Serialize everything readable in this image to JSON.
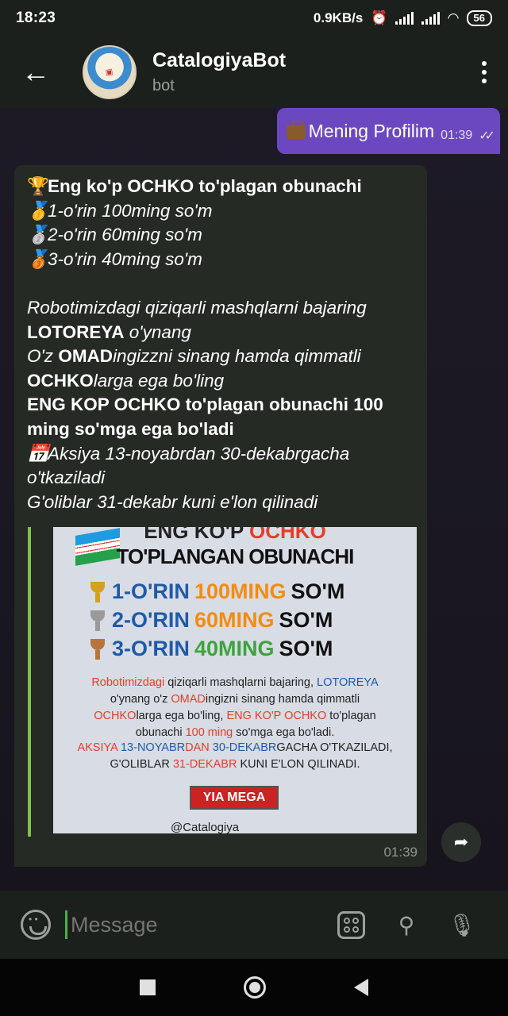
{
  "status_bar": {
    "time": "18:23",
    "speed": "0.9KB/s",
    "battery": "56"
  },
  "header": {
    "title": "CatalogiyaBot",
    "subtitle": "bot"
  },
  "outgoing": {
    "text": "Mening Profilim",
    "time": "01:39"
  },
  "incoming": {
    "line1": "Eng ko'p OCHKO to'plagan obunachi",
    "line2": "1-o'rin 100ming so'm",
    "line3": "2-o'rin 60ming so'm",
    "line4": "3-o'rin 40ming so'm",
    "line5": "Robotimizdagi qiziqarli mashqlarni bajaring",
    "line6_bold": "LOTOREYA",
    "line6_rest": " o'ynang",
    "line7_a": " O'z ",
    "line7_bold": "OMAD",
    "line7_rest": "ingizzni sinang  hamda qimmatli",
    "line8_bold": "OCHKO",
    "line8_rest": "larga ega bo'ling",
    "line9": "ENG KOP OCHKO to'plagan obunachi 100",
    "line10": "ming so'mga ega bo'ladi",
    "line11": "Aksiya 13-noyabrdan 30-dekabrgacha",
    "line12": "o'tkaziladi",
    "line13": "G'oliblar 31-dekabr kuni e'lon qilinadi",
    "time": "01:39"
  },
  "poster": {
    "head1_a": "ENG KO'P ",
    "head1_b": "OCHKO",
    "head2": "TO'PLANGAN OBUNACHI",
    "rows": [
      {
        "place": "1-O'RIN ",
        "amount": "100MING ",
        "unit": "SO'M"
      },
      {
        "place": "2-O'RIN ",
        "amount": "60MING ",
        "unit": "SO'M"
      },
      {
        "place": "3-O'RIN ",
        "amount": "40MING ",
        "unit": "SO'M"
      }
    ],
    "b1_r": "Robotimizdagi",
    "b1_rest": " qiziqarli mashqlarni bajaring, ",
    "b1_r2": "LOTOREYA",
    "b2_a": "o'ynang o'z ",
    "b2_r": "OMAD",
    "b2_rest": "ingizni sinang  hamda qimmatli",
    "b3_r": "OCHKO",
    "b3_rest": "larga ega bo'ling, ",
    "b3_r2": "ENG KO'P OCHKO",
    "b3_rest2": " to'plagan",
    "b4_a": "obunachi ",
    "b4_r": "100 ming",
    "b4_rest": " so'mga ega bo'ladi.",
    "f1_r": "AKSIYA ",
    "f1_b": "13-NOYABR",
    "f1_a": "DAN ",
    "f1_b2": "30-DEKABR",
    "f1_rest": "GACHA O'TKAZILADI,",
    "f2_a": "G'OLIBLAR ",
    "f2_b": "31-DEKABR",
    "f2_rest": " KUNI E'LON QILINADI.",
    "logo": "YIA MEGA",
    "handle": "@Catalogiya"
  },
  "input": {
    "placeholder": "Message"
  }
}
